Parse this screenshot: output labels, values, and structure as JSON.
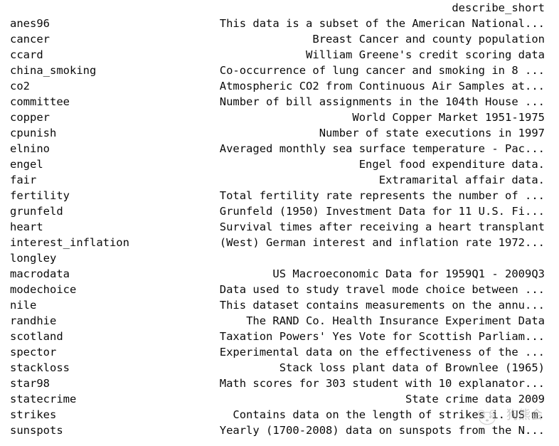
{
  "console": {
    "header": {
      "column_label": "describe_short"
    },
    "rows": [
      {
        "name": "anes96",
        "description": "This data is a subset of the American National..."
      },
      {
        "name": "cancer",
        "description": "Breast Cancer and county population"
      },
      {
        "name": "ccard",
        "description": "William Greene's credit scoring data"
      },
      {
        "name": "china_smoking",
        "description": "Co-occurrence of lung cancer and smoking in 8 ..."
      },
      {
        "name": "co2",
        "description": "Atmospheric CO2 from Continuous Air Samples at..."
      },
      {
        "name": "committee",
        "description": "Number of bill assignments in the 104th House ..."
      },
      {
        "name": "copper",
        "description": "World Copper Market 1951-1975"
      },
      {
        "name": "cpunish",
        "description": "Number of state executions in 1997"
      },
      {
        "name": "elnino",
        "description": "Averaged monthly sea surface temperature - Pac..."
      },
      {
        "name": "engel",
        "description": "Engel food expenditure data."
      },
      {
        "name": "fair",
        "description": "Extramarital affair data."
      },
      {
        "name": "fertility",
        "description": "Total fertility rate represents the number of ..."
      },
      {
        "name": "grunfeld",
        "description": "Grunfeld (1950) Investment Data for 11 U.S. Fi..."
      },
      {
        "name": "heart",
        "description": "Survival times after receiving a heart transplant"
      },
      {
        "name": "interest_inflation",
        "description": "(West) German interest and inflation rate 1972..."
      },
      {
        "name": "longley",
        "description": ""
      },
      {
        "name": "macrodata",
        "description": "US Macroeconomic Data for 1959Q1 - 2009Q3"
      },
      {
        "name": "modechoice",
        "description": "Data used to study travel mode choice between ..."
      },
      {
        "name": "nile",
        "description": "This dataset contains measurements on the annu..."
      },
      {
        "name": "randhie",
        "description": "The RAND Co. Health Insurance Experiment Data"
      },
      {
        "name": "scotland",
        "description": "Taxation Powers' Yes Vote for Scottish Parliam..."
      },
      {
        "name": "spector",
        "description": "Experimental data on the effectiveness of the ..."
      },
      {
        "name": "stackloss",
        "description": "Stack loss plant data of Brownlee (1965)"
      },
      {
        "name": "star98",
        "description": "Math scores for 303 student with 10 explanator..."
      },
      {
        "name": "statecrime",
        "description": "State crime data 2009"
      },
      {
        "name": "strikes",
        "description": "Contains data on the length of strikes i. US m."
      },
      {
        "name": "sunspots",
        "description": "Yearly (1700-2008) data on sunspots from the N..."
      }
    ]
  },
  "watermark": {
    "text": "狗熊会",
    "color": "#9a9a9a"
  },
  "theme": {
    "background": "#ffffff",
    "text_color": "#0a0a0a"
  }
}
